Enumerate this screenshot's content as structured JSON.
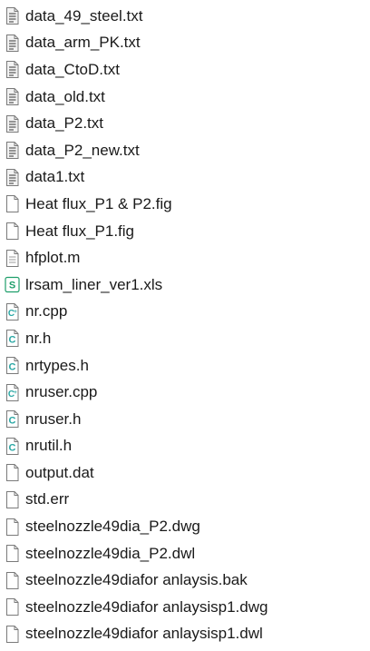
{
  "files": [
    {
      "name": "data_49_steel.txt",
      "icon": "text-file-icon"
    },
    {
      "name": "data_arm_PK.txt",
      "icon": "text-file-icon"
    },
    {
      "name": "data_CtoD.txt",
      "icon": "text-file-icon"
    },
    {
      "name": "data_old.txt",
      "icon": "text-file-icon"
    },
    {
      "name": "data_P2.txt",
      "icon": "text-file-icon"
    },
    {
      "name": "data_P2_new.txt",
      "icon": "text-file-icon"
    },
    {
      "name": "data1.txt",
      "icon": "text-file-icon"
    },
    {
      "name": "Heat flux_P1 & P2.fig",
      "icon": "blank-file-icon"
    },
    {
      "name": "Heat flux_P1.fig",
      "icon": "blank-file-icon"
    },
    {
      "name": "hfplot.m",
      "icon": "lined-file-icon"
    },
    {
      "name": "lrsam_liner_ver1.xls",
      "icon": "spreadsheet-file-icon"
    },
    {
      "name": "nr.cpp",
      "icon": "cpp-file-icon"
    },
    {
      "name": "nr.h",
      "icon": "header-file-icon"
    },
    {
      "name": "nrtypes.h",
      "icon": "header-file-icon"
    },
    {
      "name": "nruser.cpp",
      "icon": "cpp-file-icon"
    },
    {
      "name": "nruser.h",
      "icon": "header-file-icon"
    },
    {
      "name": "nrutil.h",
      "icon": "header-file-icon"
    },
    {
      "name": "output.dat",
      "icon": "blank-file-icon"
    },
    {
      "name": "std.err",
      "icon": "blank-file-icon"
    },
    {
      "name": "steelnozzle49dia_P2.dwg",
      "icon": "blank-file-icon"
    },
    {
      "name": "steelnozzle49dia_P2.dwl",
      "icon": "blank-file-icon"
    },
    {
      "name": "steelnozzle49diafor anlaysis.bak",
      "icon": "blank-file-icon"
    },
    {
      "name": "steelnozzle49diafor anlaysisp1.dwg",
      "icon": "blank-file-icon"
    },
    {
      "name": "steelnozzle49diafor anlaysisp1.dwl",
      "icon": "blank-file-icon"
    }
  ],
  "colors": {
    "icon_stroke": "#7a7a7a",
    "text_icon_fill": "#f2f2f2",
    "spreadsheet_green": "#1e9e6a",
    "code_teal": "#2aa7a4"
  }
}
